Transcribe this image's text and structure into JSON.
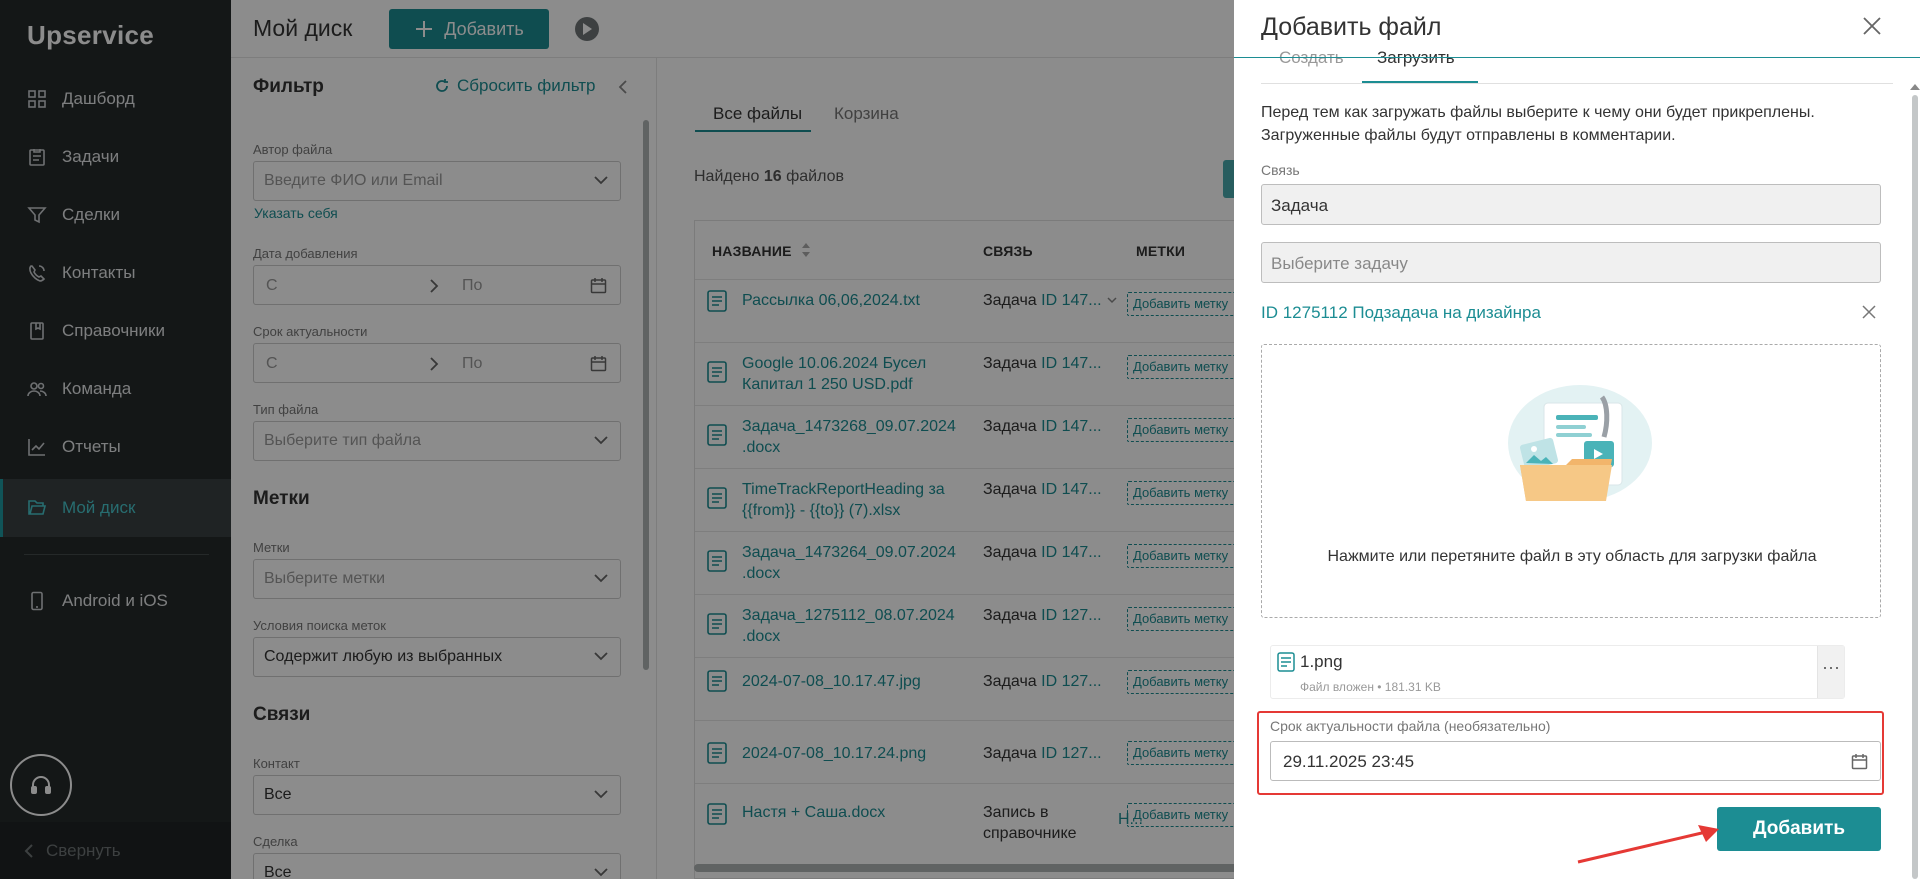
{
  "sidebar": {
    "logo": "Upservice",
    "items": [
      {
        "label": "Дашборд",
        "icon": "dashboard-icon"
      },
      {
        "label": "Задачи",
        "icon": "tasks-icon"
      },
      {
        "label": "Сделки",
        "icon": "deals-icon"
      },
      {
        "label": "Контакты",
        "icon": "contacts-icon"
      },
      {
        "label": "Справочники",
        "icon": "directory-icon"
      },
      {
        "label": "Команда",
        "icon": "team-icon"
      },
      {
        "label": "Отчеты",
        "icon": "reports-icon"
      },
      {
        "label": "Мой диск",
        "icon": "folder-icon",
        "active": true
      }
    ],
    "mobile_label": "Android и iOS",
    "collapse_label": "Свернуть"
  },
  "header": {
    "title": "Мой диск",
    "add_label": "Добавить"
  },
  "filter": {
    "title": "Фильтр",
    "reset_label": "Сбросить фильтр",
    "author_label": "Автор файла",
    "author_placeholder": "Введите ФИО или Email",
    "self_link": "Указать себя",
    "date_added_label": "Дата добавления",
    "date_from": "С",
    "date_to": "По",
    "relevance_label": "Срок актуальности",
    "file_type_label": "Тип файла",
    "file_type_placeholder": "Выберите тип файла",
    "tags_section": "Метки",
    "tags_label": "Метки",
    "tags_placeholder": "Выберите метки",
    "tag_search_label": "Условия поиска меток",
    "tag_search_value": "Содержит любую из выбранных",
    "links_section": "Связи",
    "contact_label": "Контакт",
    "contact_value": "Все",
    "deal_label": "Сделка",
    "deal_value": "Все"
  },
  "main": {
    "tabs": [
      "Все файлы",
      "Корзина"
    ],
    "found_prefix": "Найдено",
    "found_count": "16",
    "found_suffix": "файлов",
    "columns": [
      "НАЗВАНИЕ",
      "СВЯЗЬ",
      "МЕТКИ"
    ],
    "rows": [
      {
        "name": "Рассылка 06,06,2024.txt",
        "rel": "Задача",
        "rel_id": "ID 147...",
        "tag": "Добавить метку"
      },
      {
        "name": "Google 10.06.2024 Бусел Капитал 1 250 USD.pdf",
        "rel": "Задача",
        "rel_id": "ID 147...",
        "tag": "Добавить метку"
      },
      {
        "name": "Задача_1473268_09.07.2024 .docx",
        "rel": "Задача",
        "rel_id": "ID 147...",
        "tag": "Добавить метку"
      },
      {
        "name": "TimeTrackReportHeading за {{from}} - {{to}} (7).xlsx",
        "rel": "Задача",
        "rel_id": "ID 147...",
        "tag": "Добавить метку"
      },
      {
        "name": "Задача_1473264_09.07.2024 .docx",
        "rel": "Задача",
        "rel_id": "ID 147...",
        "tag": "Добавить метку"
      },
      {
        "name": "Задача_1275112_08.07.2024 .docx",
        "rel": "Задача",
        "rel_id": "ID 127...",
        "tag": "Добавить метку"
      },
      {
        "name": "2024-07-08_10.17.47.jpg",
        "rel": "Задача",
        "rel_id": "ID 127...",
        "tag": "Добавить метку"
      },
      {
        "name": "2024-07-08_10.17.24.png",
        "rel": "Задача",
        "rel_id": "ID 127...",
        "tag": "Добавить метку"
      },
      {
        "name": "Настя + Саша.docx",
        "rel": "Запись в справочнике",
        "rel_id": "Н...",
        "tag": "Добавить метку"
      }
    ]
  },
  "drawer": {
    "title": "Добавить файл",
    "tabs": [
      "Создать",
      "Загрузить"
    ],
    "info": "Перед тем как загружать файлы выберите к чему они будет прикреплены. Загруженные файлы будут отправлены в комментарии.",
    "link_label": "Связь",
    "link_value": "Задача",
    "task_placeholder": "Выберите задачу",
    "linked_task": "ID 1275112 Подзадача на дизайнра",
    "dropzone_text": "Нажмите или перетяните файл в эту область для загрузки файла",
    "file": {
      "name": "1.png",
      "meta": "Файл вложен • 181.31 KB",
      "more": "⋯"
    },
    "date_label": "Срок актуальности файла (необязательно)",
    "date_value": "29.11.2025 23:45",
    "submit_label": "Добавить"
  },
  "colors": {
    "accent": "#1c8d93",
    "sidebar": "#262a2b",
    "highlight": "#e53935"
  }
}
